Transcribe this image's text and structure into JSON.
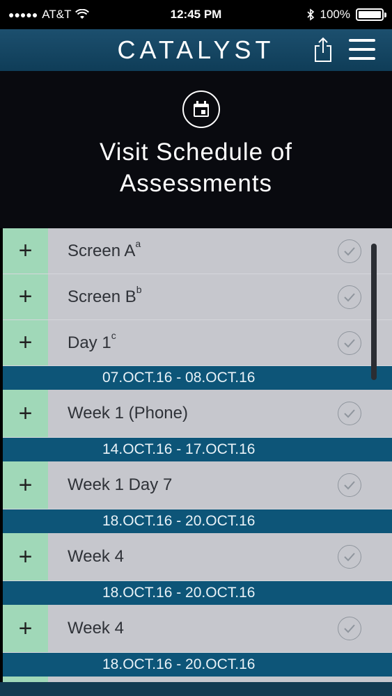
{
  "status": {
    "carrier": "AT&T",
    "time": "12:45 PM",
    "battery": "100%"
  },
  "header": {
    "title": "CATALYST",
    "share_icon": "share-icon",
    "menu_icon": "hamburger-menu-icon"
  },
  "hero": {
    "icon": "calendar-icon",
    "title_line1": "Visit Schedule of",
    "title_line2": "Assessments"
  },
  "visits": [
    {
      "label": "Screen A",
      "sup": "a",
      "checked": true
    },
    {
      "label": "Screen B",
      "sup": "b",
      "checked": true
    },
    {
      "label": "Day 1",
      "sup": "c",
      "checked": true,
      "date_range": "07.OCT.16 - 08.OCT.16"
    },
    {
      "label": "Week 1 (Phone)",
      "sup": "",
      "checked": true,
      "date_range": "14.OCT.16 - 17.OCT.16"
    },
    {
      "label": "Week 1 Day 7",
      "sup": "",
      "checked": true,
      "date_range": "18.OCT.16 - 20.OCT.16"
    },
    {
      "label": "Week 4",
      "sup": "",
      "checked": true,
      "date_range": "18.OCT.16 - 20.OCT.16"
    },
    {
      "label": "Week 4",
      "sup": "",
      "checked": true,
      "date_range": "18.OCT.16 - 20.OCT.16"
    }
  ],
  "colors": {
    "header_bg": "#1c4f6e",
    "plus_cell": "#a0d8b8",
    "date_band": "#0d5578",
    "row_bg": "#c6c7cd"
  }
}
